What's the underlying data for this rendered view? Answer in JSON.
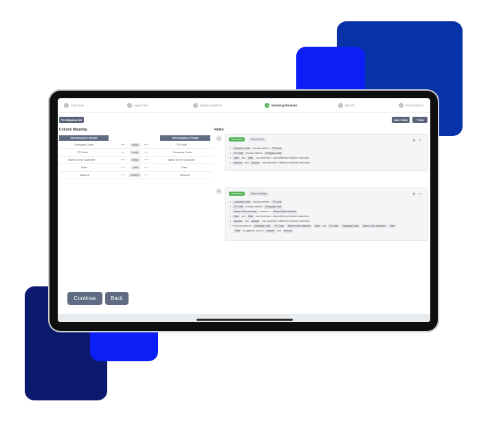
{
  "steps": [
    {
      "num": "1",
      "label": "Input Data"
    },
    {
      "num": "2",
      "label": "Apply Filter"
    },
    {
      "num": "3",
      "label": "Mapping Masters"
    },
    {
      "num": "4",
      "label": "Matching Routines"
    },
    {
      "num": "5",
      "label": "Results"
    },
    {
      "num": "6",
      "label": "Reconciliation"
    }
  ],
  "toolbar": {
    "file_mapping": "File Mapping Info",
    "save_rules": "Save Rules",
    "add_rule": "+ Rule"
  },
  "mapping": {
    "title": "Column Mapping",
    "left_header": "Intercompany 1 Simple",
    "right_header": "Intercompany 2 Simple",
    "rows": [
      {
        "left": "Company Code",
        "type": "string",
        "right": "TP Code"
      },
      {
        "left": "TP Code",
        "type": "string",
        "right": "Company Code"
      },
      {
        "left": "Name of the customer",
        "type": "string",
        "right": "Name of the customer"
      },
      {
        "left": "Date",
        "type": "date",
        "right": "Date"
      },
      {
        "left": "Amount",
        "type": "number",
        "right": "Amount"
      }
    ]
  },
  "rules": {
    "title": "Rules",
    "rule1": {
      "num": "1",
      "auto": "Automated",
      "type": "One to One",
      "conds": [
        [
          "Company Code",
          "exactly matches",
          "TP Code"
        ],
        [
          "TP Code",
          "exactly matches",
          "Company Code"
        ],
        [
          "Date",
          "and",
          "Date",
          "has maximum 1 days difference between eachother"
        ],
        [
          "Amount",
          "and",
          "Amount",
          "has maximum 0 difference between eachother"
        ]
      ]
    },
    "rule2": {
      "num": "2",
      "auto": "Automated",
      "type": "Many to Many",
      "conds": [
        [
          "Company Code",
          "exactly matches",
          "TP Code"
        ],
        [
          "TP Code",
          "exactly matches",
          "Company Code"
        ],
        [
          "Name of the customer",
          "contains in",
          "Name of the customer"
        ],
        [
          "Date",
          "and",
          "Date",
          "has maximum 1 days difference between eachother"
        ],
        [
          "Amount",
          "and",
          "Amount",
          "has maximum 0 difference between eachother"
        ],
        [
          "Group by columns",
          "Company Code",
          "TP Code",
          "Name of the customer",
          "Date",
          "and",
          "TP Code",
          "Company Code",
          "Name of the customer",
          "Date"
        ],
        [
          "by applying",
          "sum on",
          "Amount",
          "and",
          "Amount"
        ]
      ]
    }
  },
  "nav": {
    "continue": "Continue",
    "back": "Back"
  },
  "colors": {
    "green": "#4caf50",
    "slate": "#5f6b82",
    "navy": "#0b1a6e",
    "blue": "#0a1ef5"
  },
  "icons": {
    "gear": "gear-icon",
    "close": "close-icon"
  }
}
